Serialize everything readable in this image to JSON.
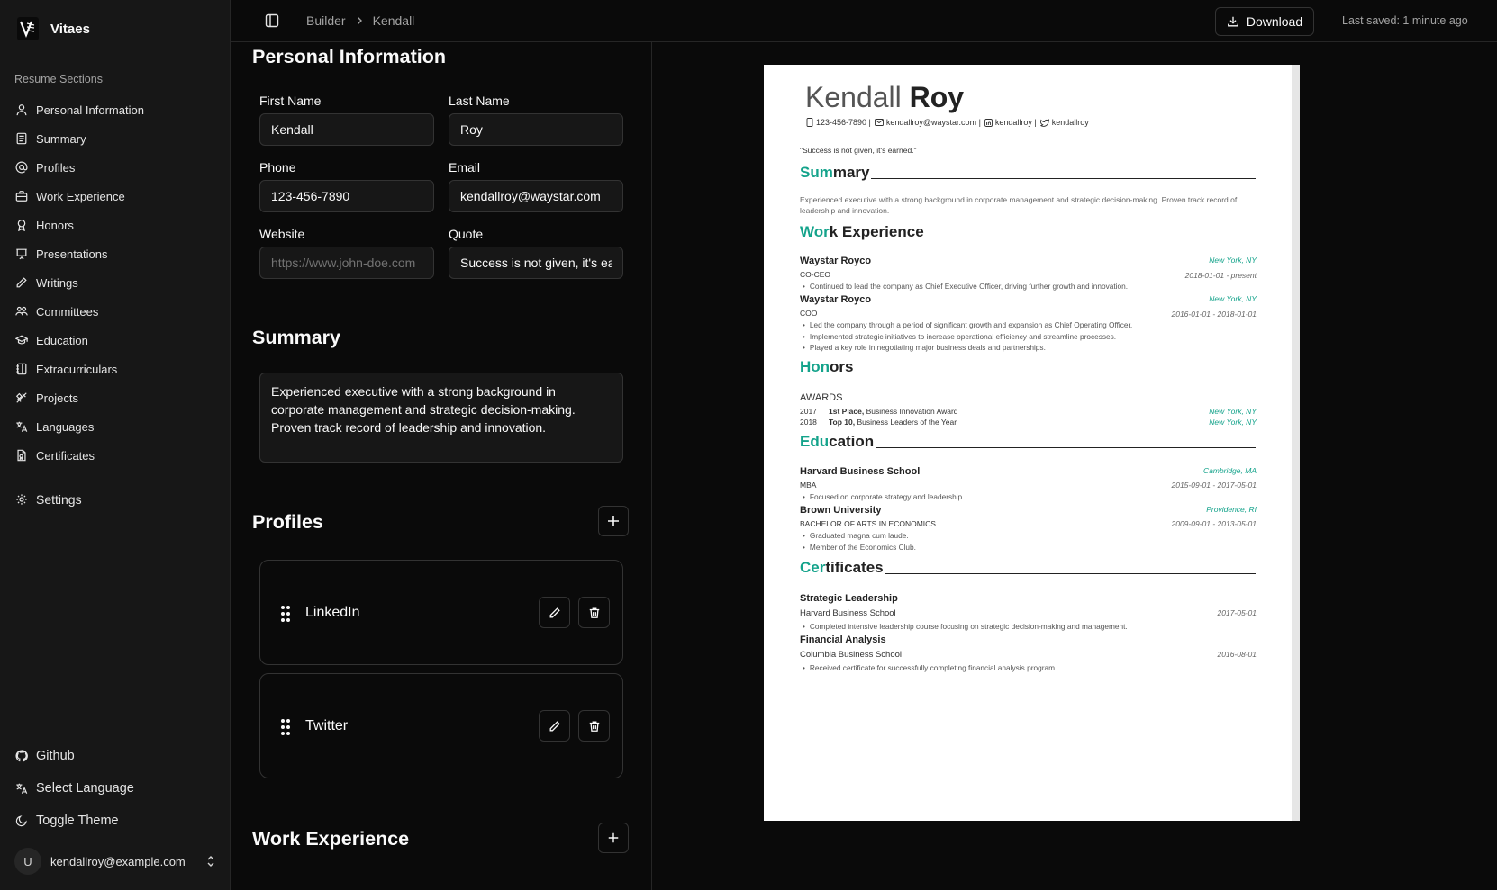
{
  "app": {
    "name": "Vitaes"
  },
  "sidebar": {
    "section_label": "Resume Sections",
    "items": [
      {
        "label": "Personal Information",
        "icon": "user-icon"
      },
      {
        "label": "Summary",
        "icon": "document-icon"
      },
      {
        "label": "Profiles",
        "icon": "at-sign-icon"
      },
      {
        "label": "Work Experience",
        "icon": "briefcase-icon"
      },
      {
        "label": "Honors",
        "icon": "award-icon"
      },
      {
        "label": "Presentations",
        "icon": "presentation-icon"
      },
      {
        "label": "Writings",
        "icon": "pen-icon"
      },
      {
        "label": "Committees",
        "icon": "users-icon"
      },
      {
        "label": "Education",
        "icon": "graduation-cap-icon"
      },
      {
        "label": "Extracurriculars",
        "icon": "notebook-icon"
      },
      {
        "label": "Projects",
        "icon": "tools-icon"
      },
      {
        "label": "Languages",
        "icon": "languages-icon"
      },
      {
        "label": "Certificates",
        "icon": "certificate-icon"
      }
    ],
    "settings_label": "Settings",
    "github_label": "Github",
    "language_label": "Select Language",
    "theme_label": "Toggle Theme",
    "user": {
      "initial": "U",
      "email": "kendallroy@example.com"
    }
  },
  "topbar": {
    "breadcrumb_root": "Builder",
    "breadcrumb_current": "Kendall",
    "download_label": "Download",
    "last_saved": "Last saved: 1 minute ago"
  },
  "personal": {
    "title": "Personal Information",
    "first_name_label": "First Name",
    "first_name": "Kendall",
    "last_name_label": "Last Name",
    "last_name": "Roy",
    "phone_label": "Phone",
    "phone": "123-456-7890",
    "email_label": "Email",
    "email": "kendallroy@waystar.com",
    "website_label": "Website",
    "website_placeholder": "https://www.john-doe.com",
    "quote_label": "Quote",
    "quote": "Success is not given, it's earned."
  },
  "summary": {
    "title": "Summary",
    "text": "Experienced executive with a strong background in corporate management and strategic decision-making. Proven track record of leadership and innovation."
  },
  "profiles": {
    "title": "Profiles",
    "items": [
      {
        "name": "LinkedIn"
      },
      {
        "name": "Twitter"
      }
    ]
  },
  "work_section": {
    "title": "Work Experience"
  },
  "resume": {
    "first_name": "Kendall",
    "last_name": "Roy",
    "phone": "123-456-7890 |",
    "email": "kendallroy@waystar.com |",
    "linkedin": "kendallroy |",
    "twitter": "kendallroy",
    "quote": "\"Success is not given, it's earned.\"",
    "accent_color": "#14a38b",
    "summary_h": {
      "acc": "Sum",
      "rest": "mary"
    },
    "summary_text": "Experienced executive with a strong background in corporate management and strategic decision-making. Proven track record of leadership and innovation.",
    "work_h": {
      "acc": "Wor",
      "rest": "k Experience"
    },
    "work": [
      {
        "org": "Waystar Royco",
        "role": "CO-CEO",
        "location": "New York, NY",
        "dates": "2018-01-01 - present",
        "bullets": [
          "Continued to lead the company as Chief Executive Officer, driving further growth and innovation."
        ]
      },
      {
        "org": "Waystar Royco",
        "role": "COO",
        "location": "New York, NY",
        "dates": "2016-01-01 - 2018-01-01",
        "bullets": [
          "Led the company through a period of significant growth and expansion as Chief Operating Officer.",
          "Implemented strategic initiatives to increase operational efficiency and streamline processes.",
          "Played a key role in negotiating major business deals and partnerships."
        ]
      }
    ],
    "honors_h": {
      "acc": "Hon",
      "rest": "ors"
    },
    "honors_category": "AWARDS",
    "honors": [
      {
        "year": "2017",
        "bold": "1st Place,",
        "text": "Business Innovation Award",
        "location": "New York, NY"
      },
      {
        "year": "2018",
        "bold": "Top 10,",
        "text": "Business Leaders of the Year",
        "location": "New York, NY"
      }
    ],
    "education_h": {
      "acc": "Edu",
      "rest": "cation"
    },
    "education": [
      {
        "school": "Harvard Business School",
        "degree": "MBA",
        "location": "Cambridge, MA",
        "dates": "2015-09-01 - 2017-05-01",
        "bullets": [
          "Focused on corporate strategy and leadership."
        ]
      },
      {
        "school": "Brown University",
        "degree": "BACHELOR OF ARTS IN ECONOMICS",
        "location": "Providence, RI",
        "dates": "2009-09-01 - 2013-05-01",
        "bullets": [
          "Graduated magna cum laude.",
          "Member of the Economics Club."
        ]
      }
    ],
    "cert_h": {
      "acc": "Cer",
      "rest": "tificates"
    },
    "certificates": [
      {
        "name": "Strategic Leadership",
        "issuer": "Harvard Business School",
        "date": "2017-05-01",
        "bullet": "Completed intensive leadership course focusing on strategic decision-making and management."
      },
      {
        "name": "Financial Analysis",
        "issuer": "Columbia Business School",
        "date": "2016-08-01",
        "bullet": "Received certificate for successfully completing financial analysis program."
      }
    ]
  }
}
